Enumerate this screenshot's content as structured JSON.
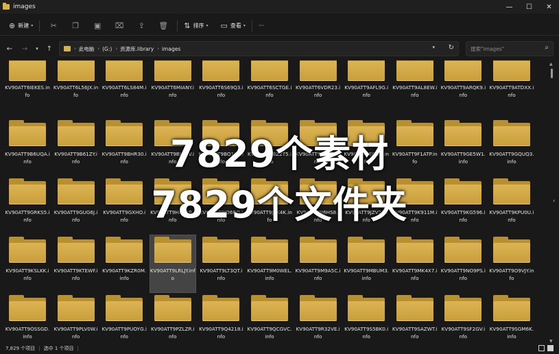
{
  "window": {
    "title": "images",
    "controls": [
      "—",
      "☐",
      "✕"
    ]
  },
  "commandbar": {
    "new_label": "新建",
    "sort_label": "排序",
    "view_label": "查看",
    "more_label": "···"
  },
  "address": {
    "crumbs": [
      "此电脑",
      "(G:)",
      "资源库.library",
      "images"
    ],
    "search_placeholder": "搜索\"images\""
  },
  "files": [
    "KV90ATT6IEKES.info",
    "KV90ATT6L56JX.info",
    "KV90ATT6LS84M.info",
    "KV90ATT6MIANY.info",
    "KV90ATT6S69Q3.info",
    "KV90ATT6SCTGE.info",
    "KV90ATT6VDR23.info",
    "KV90ATT9AFL9G.info",
    "KV90ATT9AL8EW.info",
    "KV90ATT9ARQK9.info",
    "KV90ATT9ATDXX.info",
    "KV90ATT9B6UQA.info",
    "KV90ATT9B61ZY.info",
    "KV90ATT9BHR30.info",
    "KV90ATT9BJ4MV.info",
    "KV90ATT9BQ1KB.info",
    "KV90ATT9BZ2T5.info",
    "KV90ATT9DS1R9.info",
    "KV90ATT9EQUB.info",
    "KV90ATT9F1ATP.info",
    "KV90ATT9GE5W1.info",
    "KV90ATT9GQUQ3.info",
    "KV90ATT9GRKS5.info",
    "KV90ATT9GUG6J.info",
    "KV90ATT9GXHO.info",
    "KV90ATT9HA2BB.info",
    "KV90ATT9IO6RO.info",
    "KV90ATT9J2K4K.info",
    "KV90ATT9J6HS8.info",
    "KV90ATT9JZV22.info",
    "KV90ATT9K911M.info",
    "KV90ATT9KG596.info",
    "KV90ATT9KPU0U.info",
    "KV90ATT9KSLKK.info",
    "KV90ATT9KTEWF.info",
    "KV90ATT9KZR0M.info",
    "KV90ATT9LRLJY.info",
    "KV90ATT9LT3QT.info",
    "KV90ATT9M0WEL.info",
    "KV90ATT9M9A5C.info",
    "KV90ATT9MBUM3.info",
    "KV90ATT9MK4X7.info",
    "KV90ATT9NO9PS.info",
    "KV90ATT9O9VJY.info",
    "KV90ATT9OSSGD.info",
    "KV90ATT9PLV0W.info",
    "KV90ATT9PUOYG.info",
    "KV90ATT9PZLZR.info",
    "KV90ATT9Q4218.info",
    "KV90ATT9QCGVC.info",
    "KV90ATT9R32VE.info",
    "KV90ATT9S5BK0.info",
    "KV90ATT9SAZWT.info",
    "KV90ATT9SF2GV.info",
    "KV90ATT9SGM6K.info"
  ],
  "selected_index": 36,
  "overlay": {
    "line1": "7829个素材",
    "line2": "7829个文件夹"
  },
  "status": {
    "count": "7,829 个项目",
    "selection": "选中 1 个项目"
  },
  "colors": {
    "folder": "#dcb454",
    "background": "#191919"
  }
}
